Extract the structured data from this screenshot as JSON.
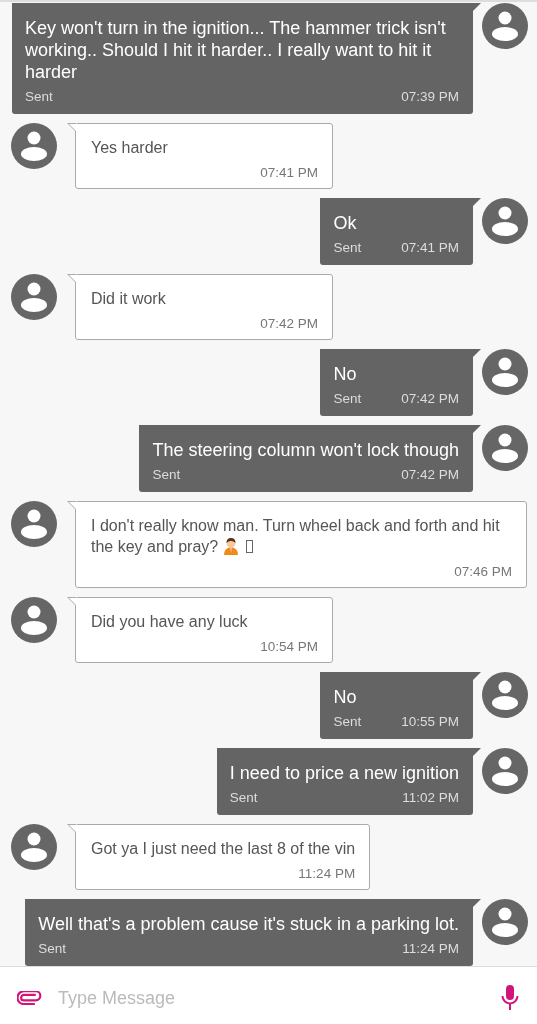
{
  "messages": [
    {
      "kind": "sent",
      "text": "Key won't turn in the ignition... The hammer trick isn't working.. Should I hit it harder.. I really want to hit it harder",
      "status": "Sent",
      "time": "07:39 PM"
    },
    {
      "kind": "received",
      "text": "Yes harder",
      "time": "07:41 PM"
    },
    {
      "kind": "sent",
      "text": "Ok",
      "status": "Sent",
      "time": "07:41 PM"
    },
    {
      "kind": "received",
      "text": "Did it work",
      "time": "07:42 PM"
    },
    {
      "kind": "sent",
      "text": "No",
      "status": "Sent",
      "time": "07:42 PM"
    },
    {
      "kind": "sent",
      "text": "The steering column won't lock though",
      "status": "Sent",
      "time": "07:42 PM"
    },
    {
      "kind": "received",
      "text": "I don't really know man.  Turn wheel back and forth and hit the key and pray?",
      "emoji": true,
      "time": "07:46 PM"
    },
    {
      "kind": "received",
      "text": "Did you have any luck",
      "time": "10:54 PM"
    },
    {
      "kind": "sent",
      "text": "No",
      "status": "Sent",
      "time": "10:55 PM"
    },
    {
      "kind": "sent",
      "text": "I need to price a new ignition",
      "status": "Sent",
      "time": "11:02 PM"
    },
    {
      "kind": "received",
      "text": "Got ya I just need the last 8 of the vin",
      "time": "11:24 PM"
    },
    {
      "kind": "sent",
      "text": "Well that's a problem cause it's stuck in a parking lot.",
      "status": "Sent",
      "time": "11:24 PM"
    }
  ],
  "composer": {
    "placeholder": "Type Message"
  }
}
